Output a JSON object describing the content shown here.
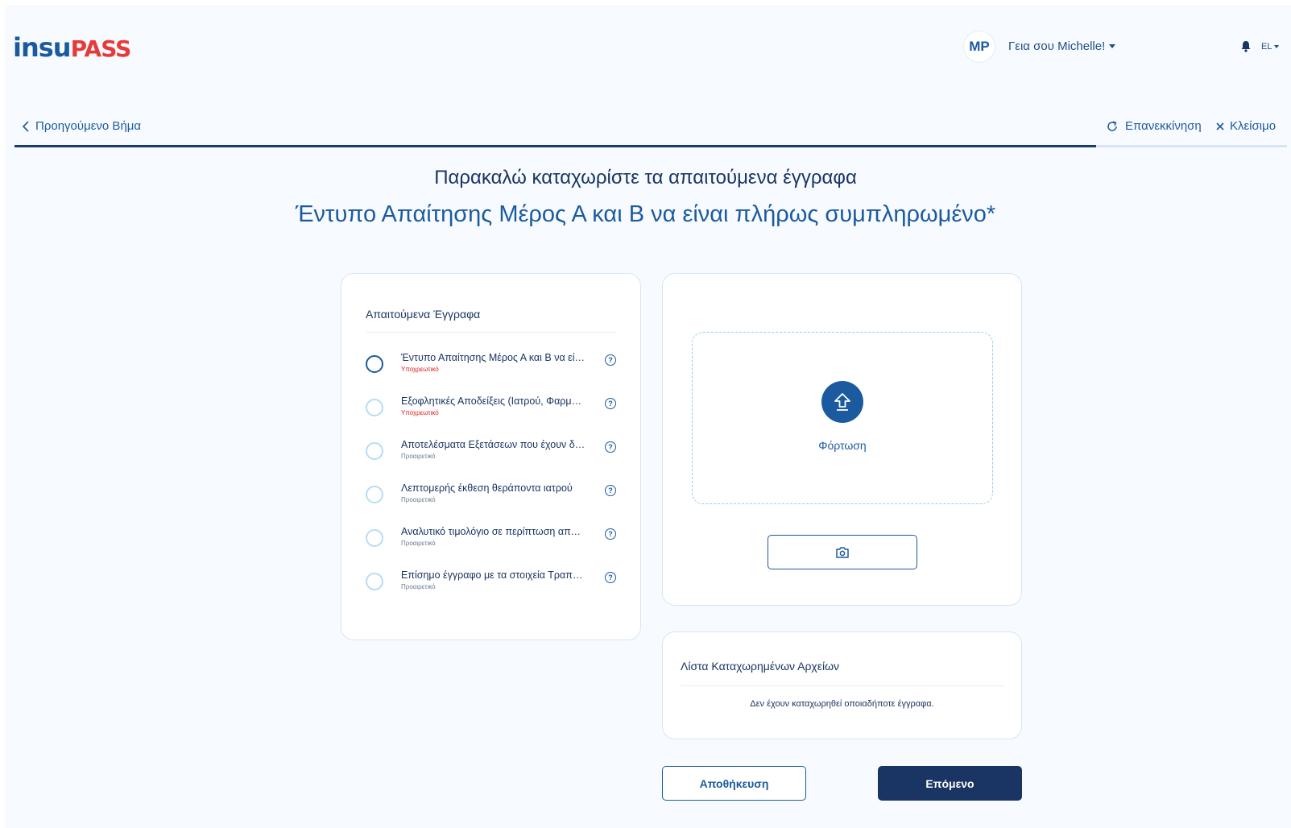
{
  "header": {
    "logo_part1": "insu",
    "logo_part2": "PASS",
    "avatar_initials": "MP",
    "greeting": "Γεια σου Michelle!",
    "language": "EL"
  },
  "nav": {
    "back_label": "Προηγούμενο Βήμα",
    "restart_label": "Επανεκκίνηση",
    "close_label": "Κλείσιμο",
    "progress_fraction": 0.85
  },
  "titles": {
    "main": "Παρακαλώ καταχωρίστε τα απαιτούμενα έγγραφα",
    "current_document": "Έντυπο Απαίτησης Μέρος Α και Β να είναι πλήρως συμπληρωμένο*"
  },
  "documents": {
    "heading": "Απαιτούμενα Έγγραφα",
    "items": [
      {
        "name": "Έντυπο Απαίτησης Μέρος Α και Β να είνα...",
        "status": "Υποχρεωτικό"
      },
      {
        "name": "Εξοφλητικές Αποδείξεις (Ιατρού, Φαρμακεί...",
        "status": "Υποχρεωτικό"
      },
      {
        "name": "Αποτελέσματα Εξετάσεων που έχουν διενε...",
        "status": "Προαιρετικό"
      },
      {
        "name": "Λεπτομερής έκθεση θεράποντα ιατρού",
        "status": "Προαιρετικό"
      },
      {
        "name": "Αναλυτικό τιμολόγιο σε περίπτωση απαιτη...",
        "status": "Προαιρετικό"
      },
      {
        "name": "Επίσημο έγγραφο με τα στοιχεία Τραπεζικο...",
        "status": "Προαιρετικό"
      }
    ],
    "help_glyph": "?"
  },
  "upload": {
    "label": "Φόρτωση",
    "icon": "upload-arrow-icon",
    "camera_icon": "camera-icon"
  },
  "files": {
    "heading": "Λίστα Καταχωρημένων Αρχείων",
    "empty_message": "Δεν έχουν καταχωρηθεί οποιαδήποτε έγγραφα."
  },
  "actions": {
    "save_label": "Αποθήκευση",
    "next_label": "Επόμενο"
  },
  "colors": {
    "primary": "#1c5a9f",
    "dark_navy": "#1a3563",
    "mandatory": "#e01919",
    "brand_red": "#e63b3b"
  }
}
